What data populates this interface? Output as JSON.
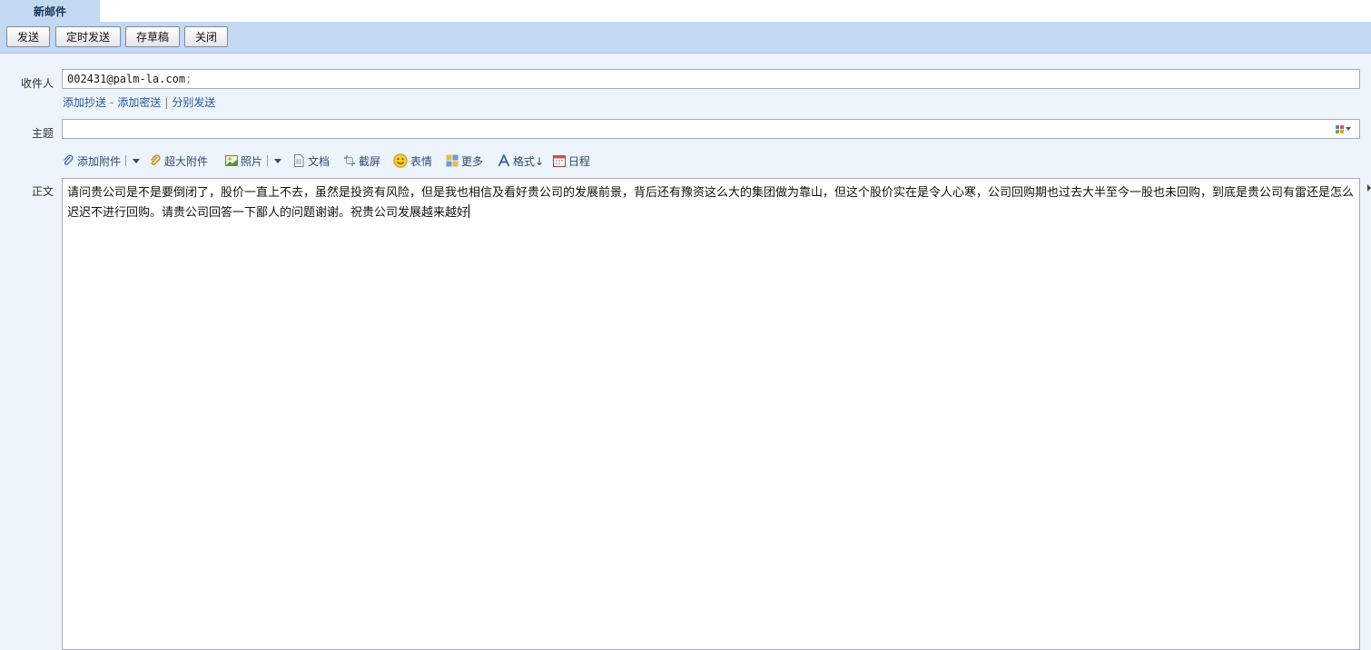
{
  "tab": {
    "title": "新邮件"
  },
  "toolbar": {
    "send": "发送",
    "scheduled_send": "定时发送",
    "save_draft": "存草稿",
    "close": "关闭"
  },
  "form": {
    "recipients_label": "收件人",
    "recipients_value": "002431@palm-la.com",
    "recipients_separator": ";",
    "add_cc": "添加抄送",
    "link_dash": "-",
    "add_bcc": "添加密送",
    "link_pipe": "|",
    "separate_send": "分别发送",
    "subject_label": "主题",
    "subject_value": "",
    "body_label": "正文",
    "body_text": "请问贵公司是不是要倒闭了，股价一直上不去，虽然是投资有风险，但是我也相信及看好贵公司的发展前景，背后还有豫资这么大的集团做为靠山，但这个股价实在是令人心寒，公司回购期也过去大半至今一股也未回购，到底是贵公司有雷还是怎么迟迟不进行回购。请贵公司回答一下鄙人的问题谢谢。祝贵公司发展越来越好"
  },
  "format_toolbar": {
    "add_attachment": "添加附件",
    "large_attachment": "超大附件",
    "photo": "照片",
    "document": "文档",
    "screenshot": "截屏",
    "emoji": "表情",
    "more": "更多",
    "format": "格式↓",
    "calendar": "日程"
  },
  "icons": {
    "attachment": "paperclip-icon",
    "large_attachment": "large-paperclip-icon",
    "photo": "photo-icon",
    "document": "document-icon",
    "screenshot": "scissors-icon",
    "emoji": "smiley-icon",
    "more": "grid-icon",
    "format": "font-a-icon",
    "calendar": "calendar-icon"
  },
  "colors": {
    "toolbar_bg": "#c3d9f1",
    "page_bg": "#eef4fb",
    "link": "#24579e"
  }
}
